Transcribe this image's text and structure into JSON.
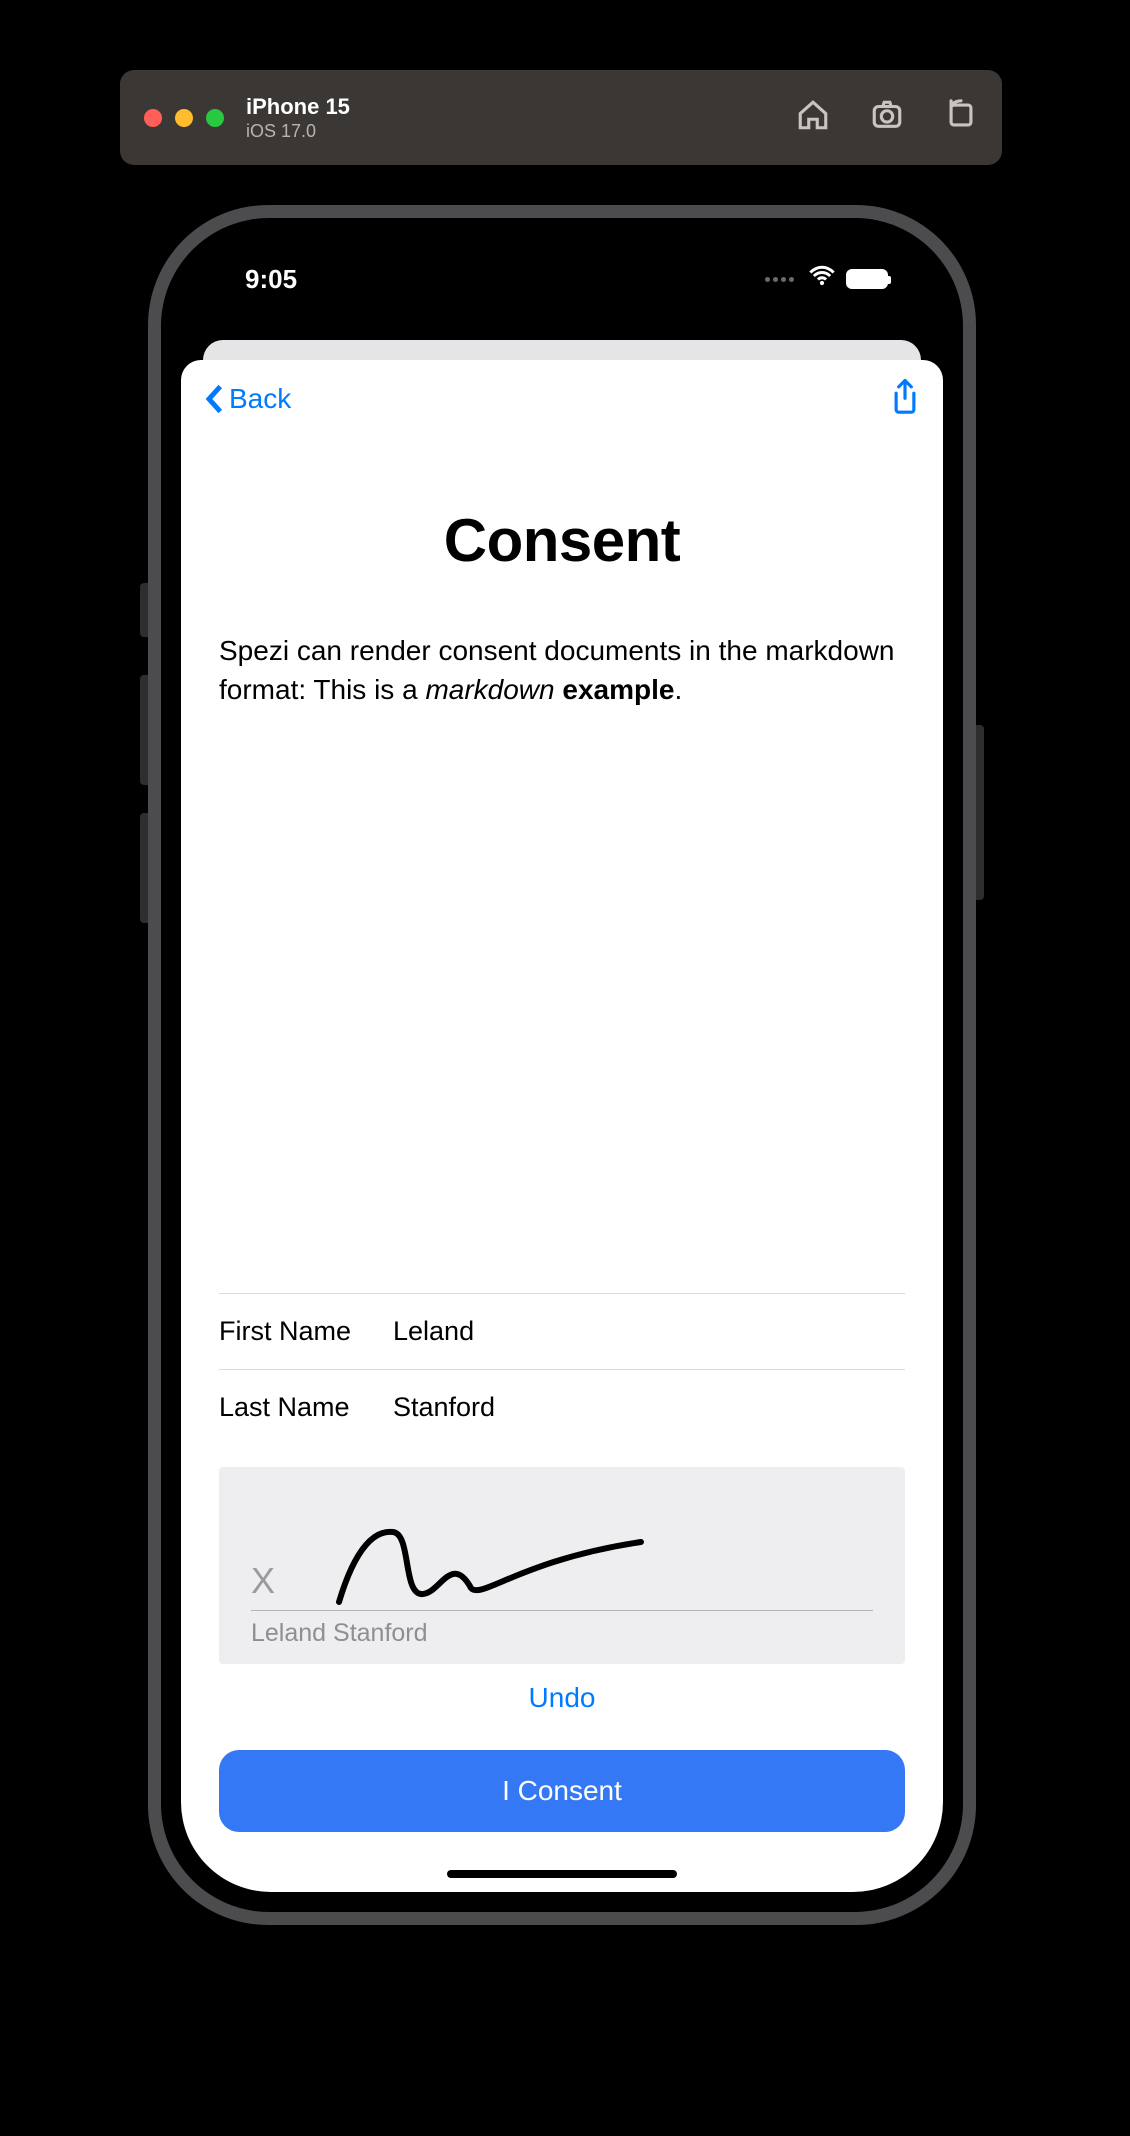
{
  "simulator": {
    "device": "iPhone 15",
    "os": "iOS 17.0"
  },
  "statusBar": {
    "time": "9:05"
  },
  "nav": {
    "back": "Back"
  },
  "page": {
    "title": "Consent",
    "body_prefix": "Spezi can render consent documents in the markdown format: This is a ",
    "body_italic": "markdown",
    "body_sep": " ",
    "body_bold": "example",
    "body_suffix": "."
  },
  "form": {
    "firstNameLabel": "First Name",
    "firstNameValue": "Leland",
    "lastNameLabel": "Last Name",
    "lastNameValue": "Stanford"
  },
  "signature": {
    "x": "X",
    "printedName": "Leland Stanford",
    "undo": "Undo"
  },
  "actions": {
    "consent": "I Consent"
  }
}
